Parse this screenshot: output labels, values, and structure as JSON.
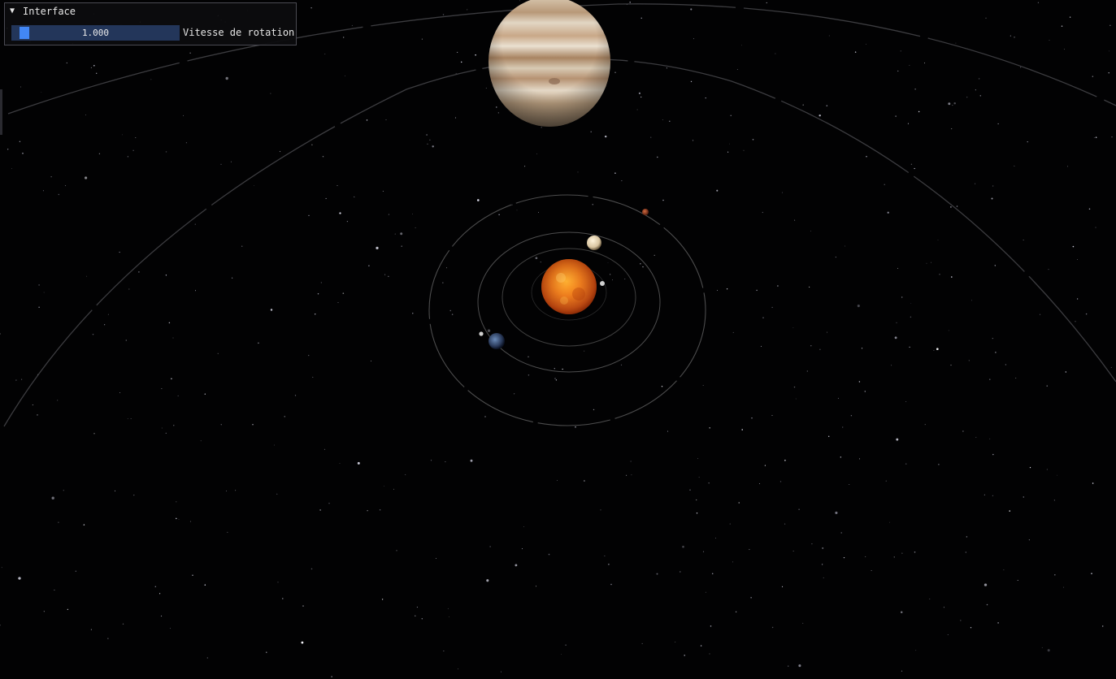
{
  "panel": {
    "title": "Interface",
    "collapse_arrow": "▼",
    "collapsed": false
  },
  "rotation_speed": {
    "label": "Vitesse de rotation",
    "value": "1.000",
    "slider_fraction": 0.02
  },
  "scene": {
    "background": "#020203",
    "sun_color": "#f07818",
    "jupiter_color": "#c8b8a0",
    "orbit_color": "#8a8a8a"
  }
}
